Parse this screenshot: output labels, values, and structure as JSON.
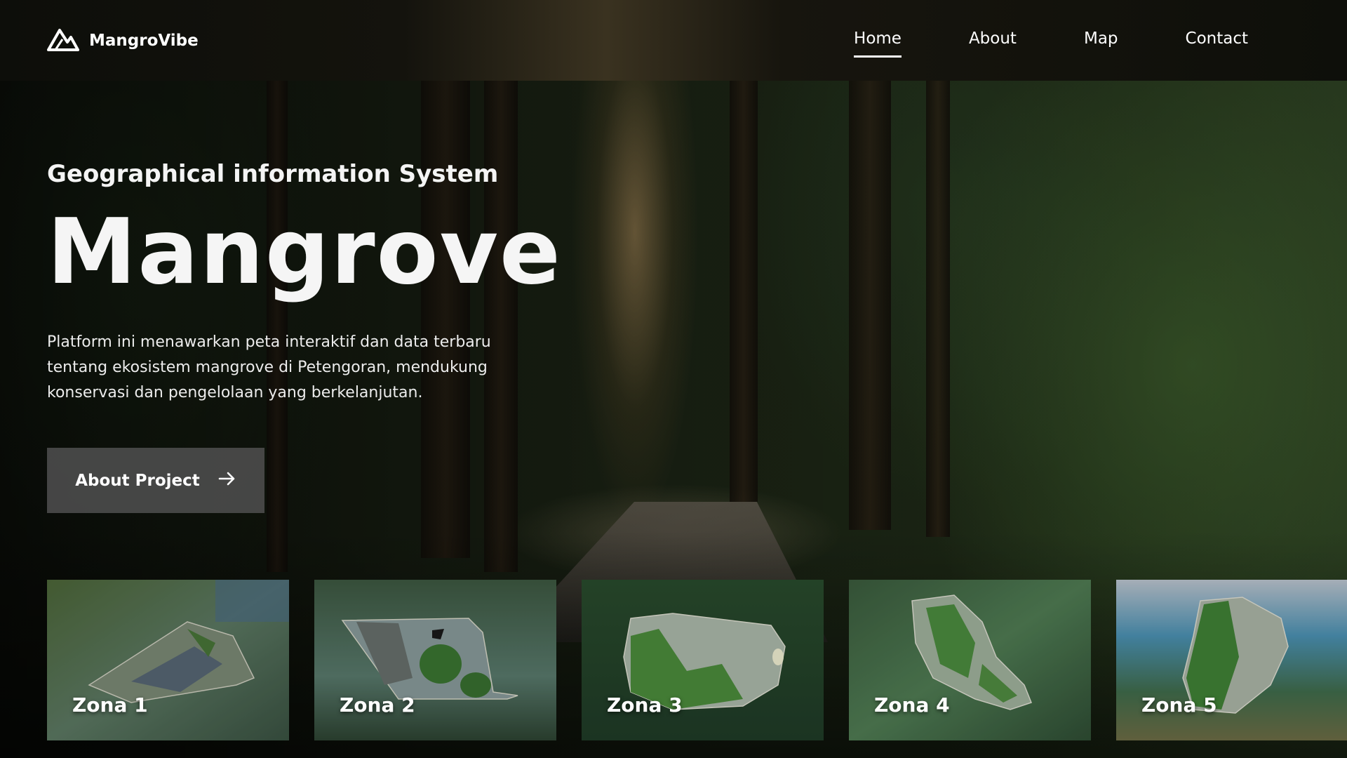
{
  "navbar": {
    "brand": "MangroVibe",
    "links": [
      {
        "label": "Home",
        "active": true
      },
      {
        "label": "About",
        "active": false
      },
      {
        "label": "Map",
        "active": false
      },
      {
        "label": "Contact",
        "active": false
      }
    ]
  },
  "hero": {
    "subtitle": "Geographical information System",
    "title": "Mangrove",
    "description": "Platform ini menawarkan peta interaktif dan data terbaru tentang ekosistem mangrove di Petengoran, mendukung konservasi dan pengelolaan yang berkelanjutan.",
    "cta_label": "About Project",
    "cta_icon": "arrow-right-icon"
  },
  "zones": [
    {
      "label": "Zona 1"
    },
    {
      "label": "Zona 2"
    },
    {
      "label": "Zona 3"
    },
    {
      "label": "Zona 4"
    },
    {
      "label": "Zona 5"
    }
  ],
  "colors": {
    "nav_bg": "#0d0e0a",
    "text": "#ffffff",
    "button_bg": "#505050",
    "forest_green": "#2a3c20"
  }
}
